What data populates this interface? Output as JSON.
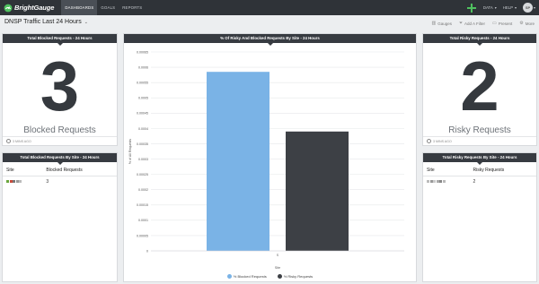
{
  "nav": {
    "brand": "BrightGauge",
    "links": [
      "DASHBOARDS",
      "GOALS",
      "REPORTS"
    ],
    "data_menu": "DATA",
    "help_menu": "HELP",
    "avatar_initials": "SP"
  },
  "dashboard": {
    "title": "DNSP Traffic Last 24 Hours",
    "toolbar": {
      "gauges": "Gauges",
      "add_filter": "Add A Filter",
      "present": "Present",
      "more": "More"
    }
  },
  "widgets": {
    "blocked_total": {
      "title": "Total Blocked Requests - 24 Hours",
      "value": "3",
      "label": "Blocked Requests",
      "updated": "3 MINS AGO"
    },
    "risky_total": {
      "title": "Total Risky Requests - 24 Hours",
      "value": "2",
      "label": "Risky Requests",
      "updated": "3 MINS AGO"
    },
    "blocked_by_site": {
      "title": "Total Blocked Requests By Site - 24 Hours",
      "columns": [
        "Site",
        "Blocked Requests"
      ],
      "rows": [
        {
          "value": "3"
        }
      ]
    },
    "risky_by_site": {
      "title": "Total Risky Requests By Site - 24 Hours",
      "columns": [
        "Site",
        "Risky Requests"
      ],
      "rows": [
        {
          "value": "2"
        }
      ]
    },
    "chart": {
      "title": "% Of Risky And Blocked Requests By Site - 24 Hours"
    }
  },
  "colors": {
    "blocked": "#7ab3e6",
    "risky": "#3d4045",
    "add": "#4fc15f",
    "header": "#373b41"
  },
  "chart_data": {
    "type": "bar",
    "title": "% Of Risky And Blocked Requests By Site - 24 Hours",
    "xlabel": "Site",
    "ylabel": "% of All Requests",
    "categories": [
      "S"
    ],
    "ylim": [
      0,
      0.00065
    ],
    "yticks": [
      "0",
      "0.00005",
      "0.0001",
      "0.00015",
      "0.0002",
      "0.00025",
      "0.0003",
      "0.00035",
      "0.0004",
      "0.00045",
      "0.0005",
      "0.00055",
      "0.0006",
      "0.00065"
    ],
    "series": [
      {
        "name": "% Blocked Requests",
        "values": [
          0.000585
        ]
      },
      {
        "name": "% Risky Requests",
        "values": [
          0.00039
        ]
      }
    ],
    "legend": "bottom",
    "grid": true
  }
}
